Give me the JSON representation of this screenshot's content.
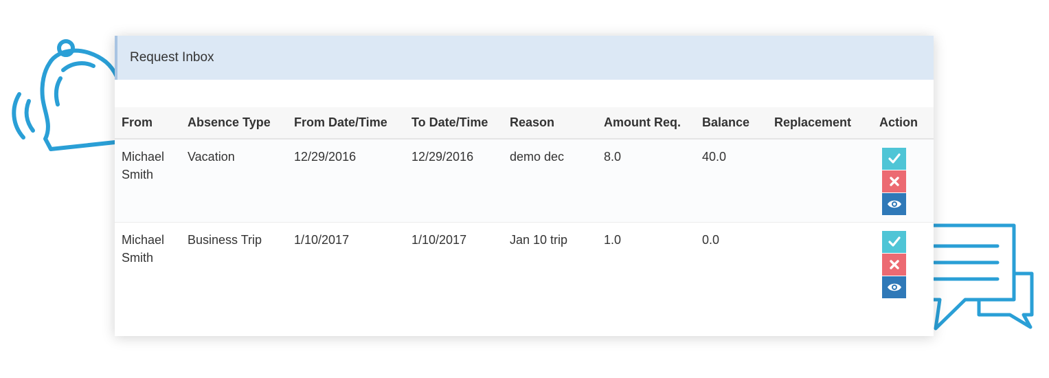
{
  "panel": {
    "title": "Request Inbox"
  },
  "table": {
    "columns": [
      "From",
      "Absence Type",
      "From Date/Time",
      "To Date/Time",
      "Reason",
      "Amount Req.",
      "Balance",
      "Replacement",
      "Action"
    ],
    "rows": [
      {
        "from_first": "Michael",
        "from_last": "Smith",
        "absence_type": "Vacation",
        "from_date": "12/29/2016",
        "to_date": "12/29/2016",
        "reason": "demo dec",
        "amount": "8.0",
        "balance": "40.0",
        "replacement": "",
        "actions": [
          "check-icon",
          "x-icon",
          "eye-icon"
        ]
      },
      {
        "from_first": "Michael",
        "from_last": "Smith",
        "absence_type": "Business Trip",
        "from_date": "1/10/2017",
        "to_date": "1/10/2017",
        "reason": "Jan 10 trip",
        "amount": "1.0",
        "balance": "0.0",
        "replacement": "",
        "actions": [
          "check-icon",
          "x-icon",
          "eye-icon"
        ]
      }
    ]
  },
  "colors": {
    "header_bg": "#dce8f5",
    "approve": "#4fc5d6",
    "reject": "#ec6a72",
    "view": "#2f79b8",
    "decoration": "#2a9fd6"
  },
  "decorations": [
    "bell-icon",
    "chat-bubbles-icon"
  ]
}
